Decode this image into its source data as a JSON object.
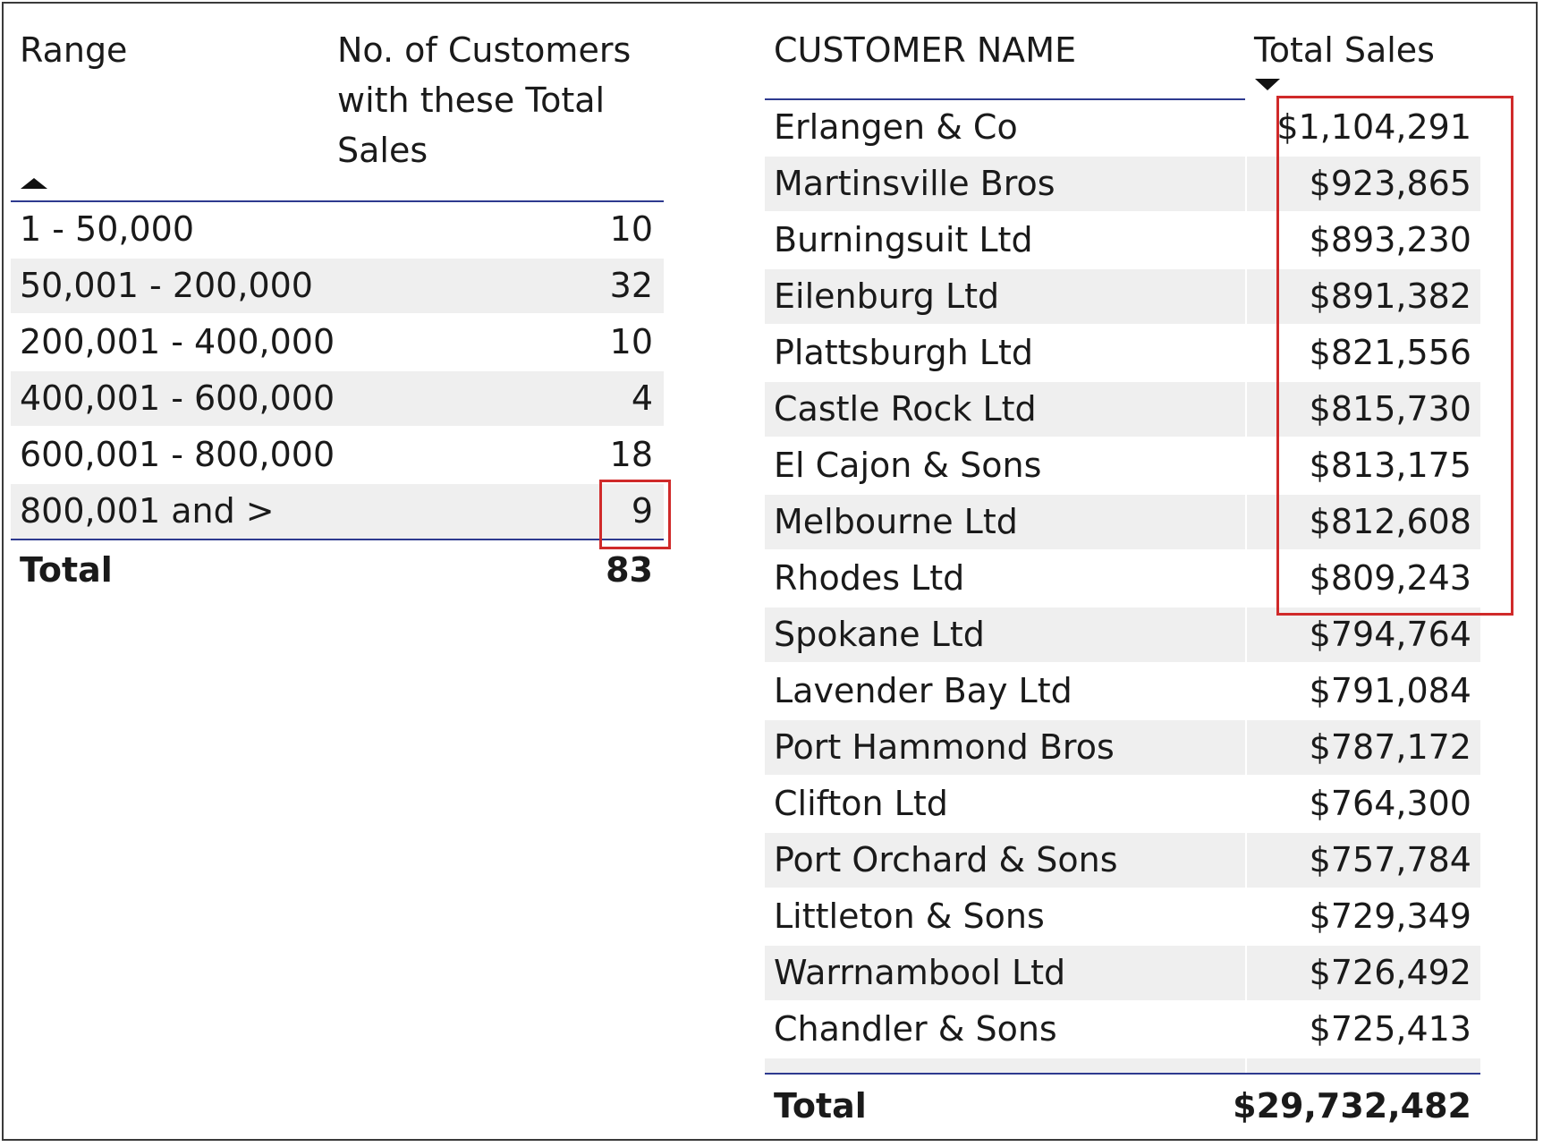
{
  "left_table": {
    "header_range": "Range",
    "header_count": "No. of Customers with these Total Sales",
    "rows": [
      {
        "range": "1 - 50,000",
        "count": "10"
      },
      {
        "range": "50,001 - 200,000",
        "count": "32"
      },
      {
        "range": "200,001 - 400,000",
        "count": "10"
      },
      {
        "range": "400,001 - 600,000",
        "count": "4"
      },
      {
        "range": "600,001 - 800,000",
        "count": "18"
      },
      {
        "range": "800,001 and >",
        "count": "9"
      }
    ],
    "total_label": "Total",
    "total_value": "83",
    "sort_direction": "ascending"
  },
  "right_table": {
    "header_name": "CUSTOMER NAME",
    "header_sales": "Total Sales",
    "sort_direction": "descending",
    "rows": [
      {
        "name": "Erlangen & Co",
        "sales": "$1,104,291"
      },
      {
        "name": "Martinsville Bros",
        "sales": "$923,865"
      },
      {
        "name": "Burningsuit Ltd",
        "sales": "$893,230"
      },
      {
        "name": "Eilenburg Ltd",
        "sales": "$891,382"
      },
      {
        "name": "Plattsburgh Ltd",
        "sales": "$821,556"
      },
      {
        "name": "Castle Rock Ltd",
        "sales": "$815,730"
      },
      {
        "name": "El Cajon & Sons",
        "sales": "$813,175"
      },
      {
        "name": "Melbourne Ltd",
        "sales": "$812,608"
      },
      {
        "name": "Rhodes Ltd",
        "sales": "$809,243"
      },
      {
        "name": "Spokane Ltd",
        "sales": "$794,764"
      },
      {
        "name": "Lavender Bay Ltd",
        "sales": "$791,084"
      },
      {
        "name": "Port Hammond Bros",
        "sales": "$787,172"
      },
      {
        "name": "Clifton Ltd",
        "sales": "$764,300"
      },
      {
        "name": "Port Orchard & Sons",
        "sales": "$757,784"
      },
      {
        "name": "Littleton & Sons",
        "sales": "$729,349"
      },
      {
        "name": "Warrnambool Ltd",
        "sales": "$726,492"
      },
      {
        "name": "Chandler & Sons",
        "sales": "$725,413"
      }
    ],
    "total_label": "Total",
    "total_value": "$29,732,482"
  },
  "colors": {
    "highlight": "#d02a2a",
    "header_rule": "#2e3a8f",
    "alt_row": "#efefef"
  }
}
